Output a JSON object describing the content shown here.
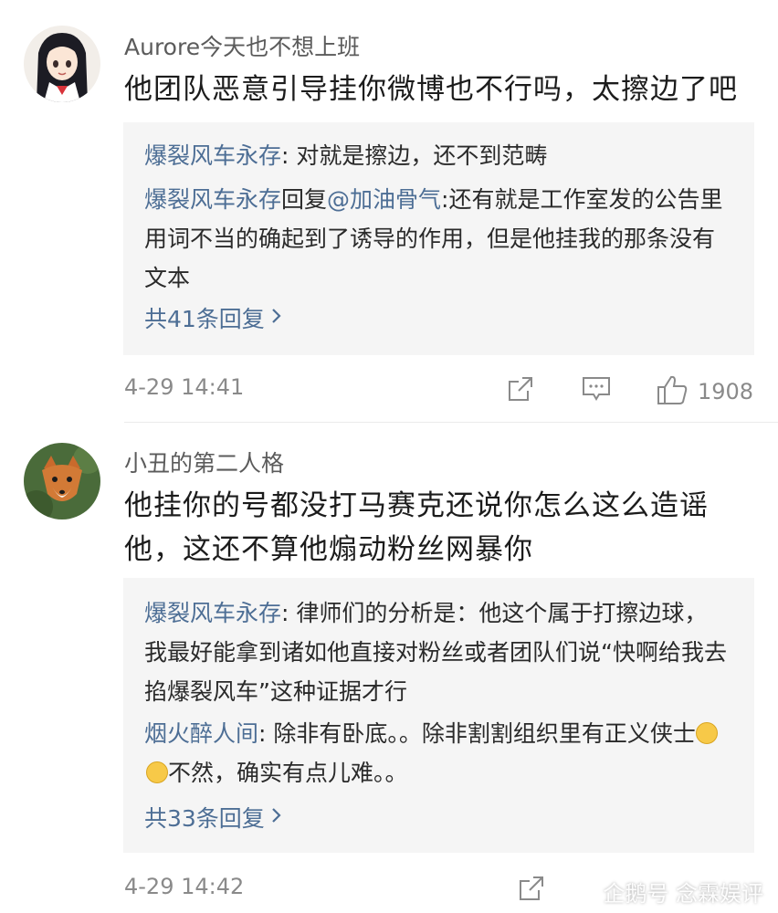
{
  "comments": [
    {
      "username": "Aurore今天也不想上班",
      "text": "他团队恶意引导挂你微博也不行吗，太擦边了吧",
      "replies": [
        {
          "author": "爆裂风车永存",
          "sep": ": ",
          "text": "对就是擦边，还不到范畴"
        },
        {
          "author": "爆裂风车永存",
          "sep": "回复",
          "mention": "@加油骨气",
          "text": ":还有就是工作室发的公告里用词不当的确起到了诱导的作用，但是他挂我的那条没有文本"
        }
      ],
      "more_replies": "共41条回复",
      "time": "4-29 14:41",
      "likes": "1908"
    },
    {
      "username": "小丑的第二人格",
      "text": "他挂你的号都没打马赛克还说你怎么这么造谣他，这还不算他煽动粉丝网暴你",
      "replies": [
        {
          "author": "爆裂风车永存",
          "sep": ": ",
          "text": "律师们的分析是：他这个属于打擦边球，我最好能拿到诸如他直接对粉丝或者团队们说“快啊给我去掐爆裂风车”这种证据才行"
        },
        {
          "author": "烟火醉人间",
          "sep": ": ",
          "text": "除非有卧底。。除非割割组织里有正义侠士",
          "text_after": "不然，确实有点儿难。。"
        }
      ],
      "more_replies": "共33条回复",
      "time": "4-29 14:42"
    }
  ],
  "watermark": "企鹅号 念霖娱评",
  "colors": {
    "link": "#4d6e95",
    "reply_bg": "#f5f5f5",
    "meta": "#8a8a8a"
  }
}
